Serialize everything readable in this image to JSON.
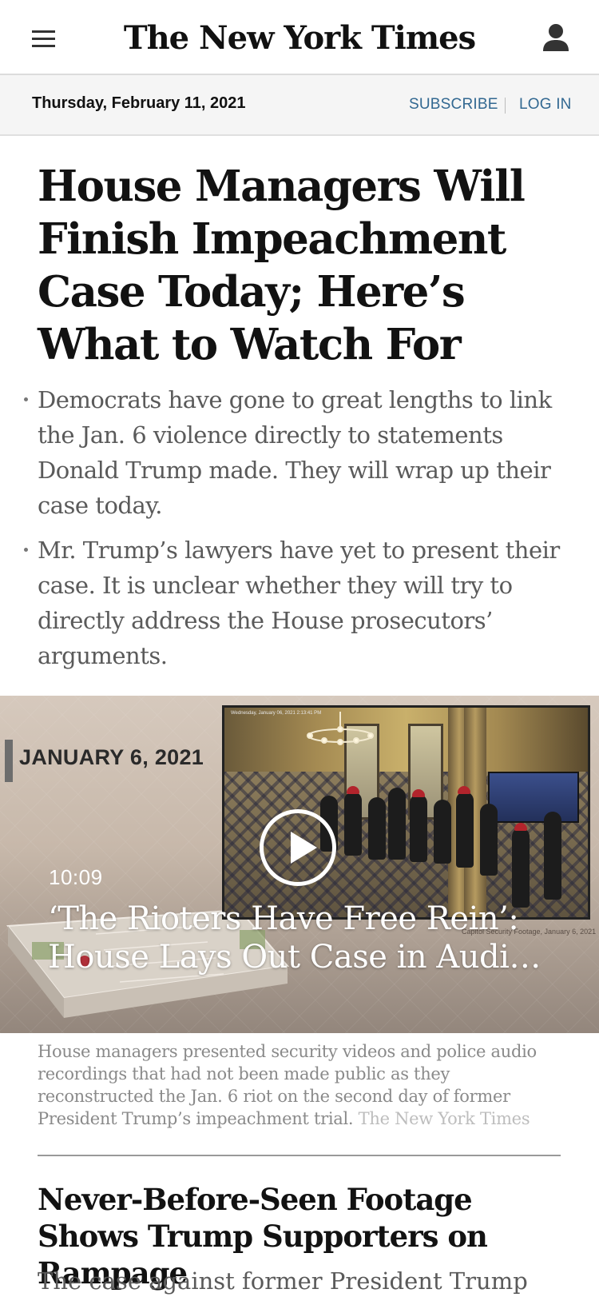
{
  "masthead": {
    "logo_text": "The New York Times",
    "menu_icon": "hamburger-menu-icon",
    "account_icon": "user-account-icon"
  },
  "datebar": {
    "date": "Thursday, February 11, 2021",
    "subscribe_label": "SUBSCRIBE",
    "login_label": "LOG IN",
    "link_color": "#326891"
  },
  "article": {
    "headline": "House Managers Will Finish Impeachment Case Today; Here’s What to Watch For",
    "summary": [
      "Democrats have gone to great lengths to link the Jan. 6 violence directly to statements Donald Trump made. They will wrap up their case today.",
      "Mr. Trump’s lawyers have yet to present their case. It is unclear whether they will try to directly address the House prosecutors’ arguments."
    ]
  },
  "video": {
    "date_label": "JANUARY 6, 2021",
    "duration": "10:09",
    "title_line1": "‘The Rioters Have Free Rein’:",
    "title_line2": "House Lays Out Case in Audio and Video",
    "footage_credit": "Capitol Security Footage, January 6, 2021",
    "footage_timestamp": "Wednesday, January 06, 2021 2:13:41 PM",
    "play_icon": "play-icon",
    "caption": "House managers presented security videos and police audio recordings that had not been made public as they reconstructed the Jan. 6 riot on the second day of former President Trump’s impeachment trial.",
    "caption_credit": "The New York Times"
  },
  "next_story": {
    "headline": "Never-Before-Seen Footage Shows Trump Supporters on Rampage",
    "snippet": "The case against former President Trump"
  }
}
